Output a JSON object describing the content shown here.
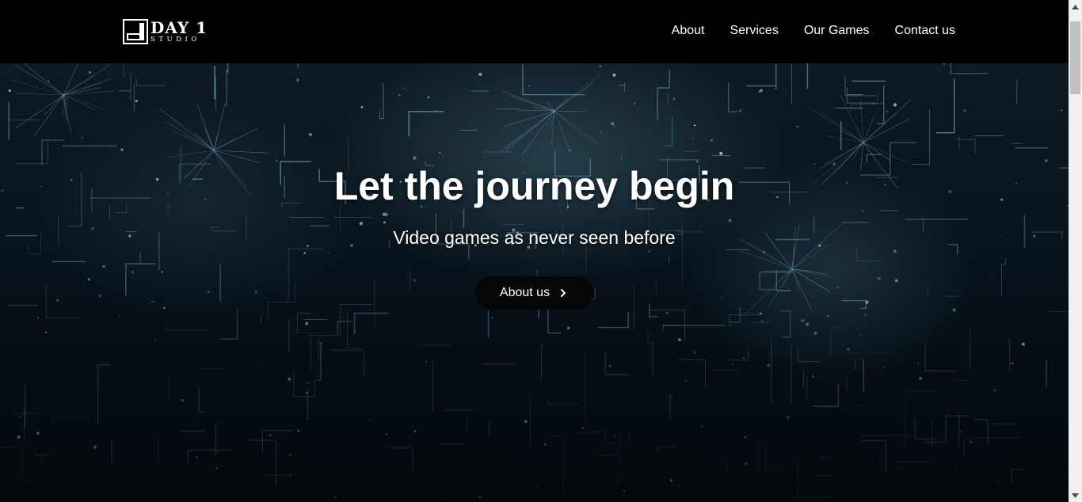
{
  "brand": {
    "name": "DAY 1",
    "tagline": "STUDIO"
  },
  "nav": {
    "items": [
      {
        "label": "About"
      },
      {
        "label": "Services"
      },
      {
        "label": "Our Games"
      },
      {
        "label": "Contact us"
      }
    ]
  },
  "hero": {
    "title": "Let the journey begin",
    "subtitle": "Video games as never seen before",
    "button_label": "About us"
  },
  "colors": {
    "navbar_bg": "#000000",
    "text": "#ffffff",
    "network_lines": "#7fb3c8",
    "button_bg": "#050607"
  }
}
